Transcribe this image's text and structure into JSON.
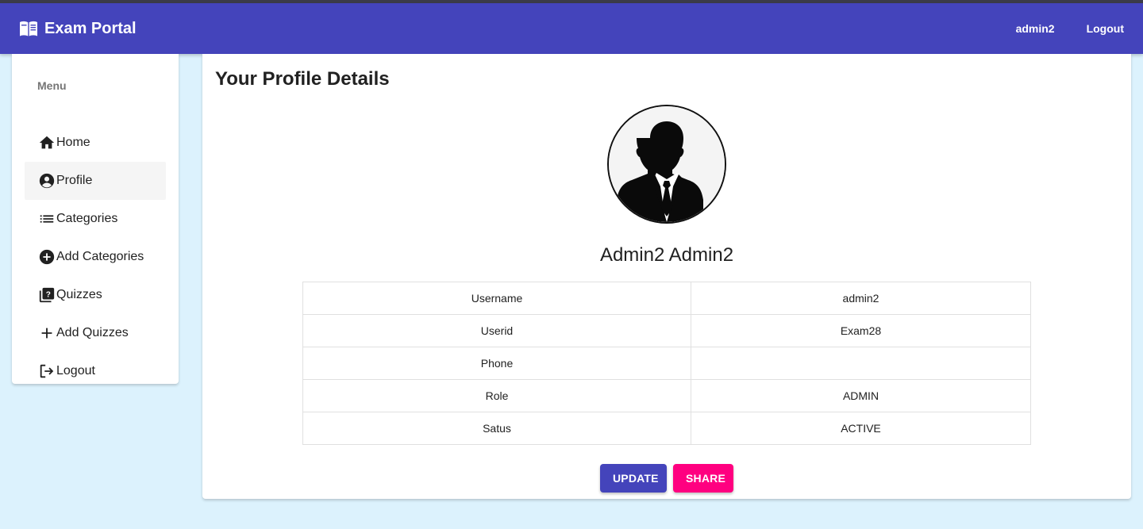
{
  "navbar": {
    "brand": "Exam Portal",
    "brand_icon": "book-icon",
    "username": "admin2",
    "logout": "Logout",
    "color": "#4444bb"
  },
  "sidebar": {
    "title": "Menu",
    "items": [
      {
        "label": "Home",
        "icon": "home-icon"
      },
      {
        "label": "Profile",
        "icon": "account-circle-icon",
        "active": true
      },
      {
        "label": "Categories",
        "icon": "list-icon"
      },
      {
        "label": "Add Categories",
        "icon": "add-circle-icon"
      },
      {
        "label": "Quizzes",
        "icon": "quiz-icon"
      },
      {
        "label": "Add Quizzes",
        "icon": "plus-icon"
      },
      {
        "label": "Logout",
        "icon": "logout-icon"
      }
    ]
  },
  "profile": {
    "heading": "Your Profile Details",
    "name": "Admin2 Admin2",
    "rows": [
      {
        "label": "Username",
        "value": "admin2"
      },
      {
        "label": "Userid",
        "value": "Exam28"
      },
      {
        "label": "Phone",
        "value": ""
      },
      {
        "label": "Role",
        "value": "ADMIN"
      },
      {
        "label": "Satus",
        "value": "ACTIVE"
      }
    ],
    "update_label": "UPDATE",
    "share_label": "SHARE"
  },
  "colors": {
    "background": "#dcf2fd",
    "primary": "#4444bb",
    "accent": "#ff0080"
  }
}
